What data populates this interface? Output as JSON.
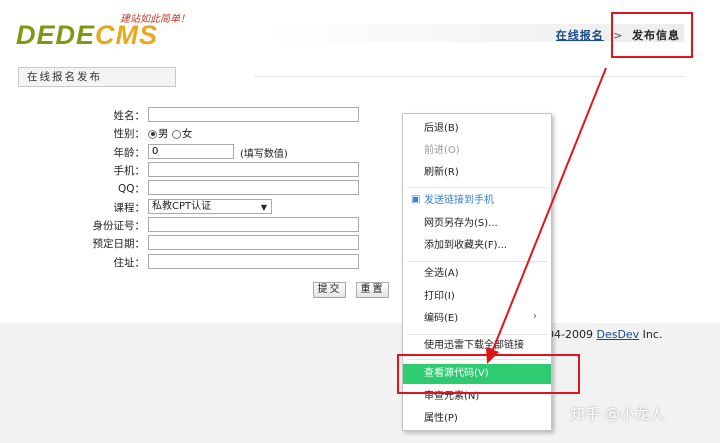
{
  "header": {
    "logo_left": "DEDE",
    "logo_right": "CMS",
    "slogan": "建站如此简单！",
    "breadcrumb_link": "在线报名",
    "breadcrumb_sep": ">",
    "breadcrumb_current": "发布信息"
  },
  "tab": {
    "label": "在线报名发布"
  },
  "form": {
    "name_label": "姓名：",
    "name_value": "",
    "gender_label": "性别：",
    "gender_male": "男",
    "gender_female": "女",
    "gender_selected": "男",
    "age_label": "年龄：",
    "age_value": "0",
    "age_hint": "(填写数值)",
    "phone_label": "手机：",
    "phone_value": "",
    "qq_label": "QQ：",
    "qq_value": "",
    "course_label": "课程：",
    "course_selected": "私教CPT认证",
    "id_label": "身份证号：",
    "id_value": "",
    "date_label": "预定日期：",
    "date_value": "",
    "address_label": "住址：",
    "address_value": "",
    "submit_label": "提交",
    "reset_label": "重置"
  },
  "footer": {
    "copyright_prefix": "004-2009 ",
    "copyright_link": "DesDev",
    "copyright_suffix": " Inc."
  },
  "context_menu": {
    "back": "后退(B)",
    "forward": "前进(O)",
    "refresh": "刷新(R)",
    "send_to_phone": "发送链接到手机",
    "save_as": "网页另存为(S)...",
    "add_favorite": "添加到收藏夹(F)...",
    "select_all": "全选(A)",
    "print": "打印(I)",
    "encoding": "编码(E)",
    "download_all": "使用迅雷下载全部链接",
    "view_source": "查看源代码(V)",
    "inspect": "审查元素(N)",
    "properties": "属性(P)"
  },
  "watermark": "知乎 @小龙人",
  "colors": {
    "annotation_red": "#e0151b",
    "highlight_green": "#2ecc71",
    "link_blue": "#1a4a8a"
  }
}
